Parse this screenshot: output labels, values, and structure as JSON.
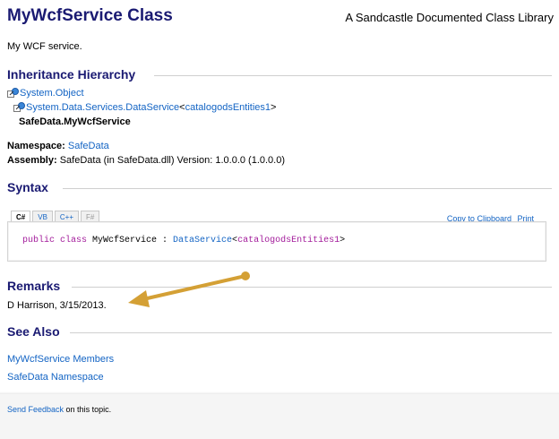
{
  "header": {
    "title": "MyWcfService Class",
    "library": "A Sandcastle Documented Class Library"
  },
  "summary": "My WCF service.",
  "inheritance": {
    "heading": "Inheritance Hierarchy",
    "items": [
      {
        "text": "System.Object"
      },
      {
        "text": "System.Data.Services.DataService",
        "open": "<",
        "generic": "catalogodsEntities1",
        "close": ">"
      },
      {
        "text": "SafeData.MyWcfService"
      }
    ]
  },
  "namespace": {
    "label": "Namespace:",
    "value": "SafeData"
  },
  "assembly": {
    "label": "Assembly:",
    "value": "SafeData (in SafeData.dll) Version: 1.0.0.0 (1.0.0.0)"
  },
  "syntax": {
    "heading": "Syntax",
    "tabs": [
      "C#",
      "VB",
      "C++",
      "F#"
    ],
    "copy_label": "Copy to Clipboard",
    "print_label": "Print",
    "code": {
      "keywords": "public class",
      "name": " MyWcfService : ",
      "base": "DataService",
      "open": "<",
      "generic": "catalogodsEntities1",
      "close": ">"
    }
  },
  "remarks": {
    "heading": "Remarks",
    "text": "D Harrison, 3/15/2013."
  },
  "see_also": {
    "heading": "See Also",
    "links": [
      "MyWcfService Members",
      "SafeData Namespace"
    ]
  },
  "footer": {
    "link": "Send Feedback",
    "text": " on this topic."
  },
  "annotation": {
    "color": "#d4a035"
  }
}
